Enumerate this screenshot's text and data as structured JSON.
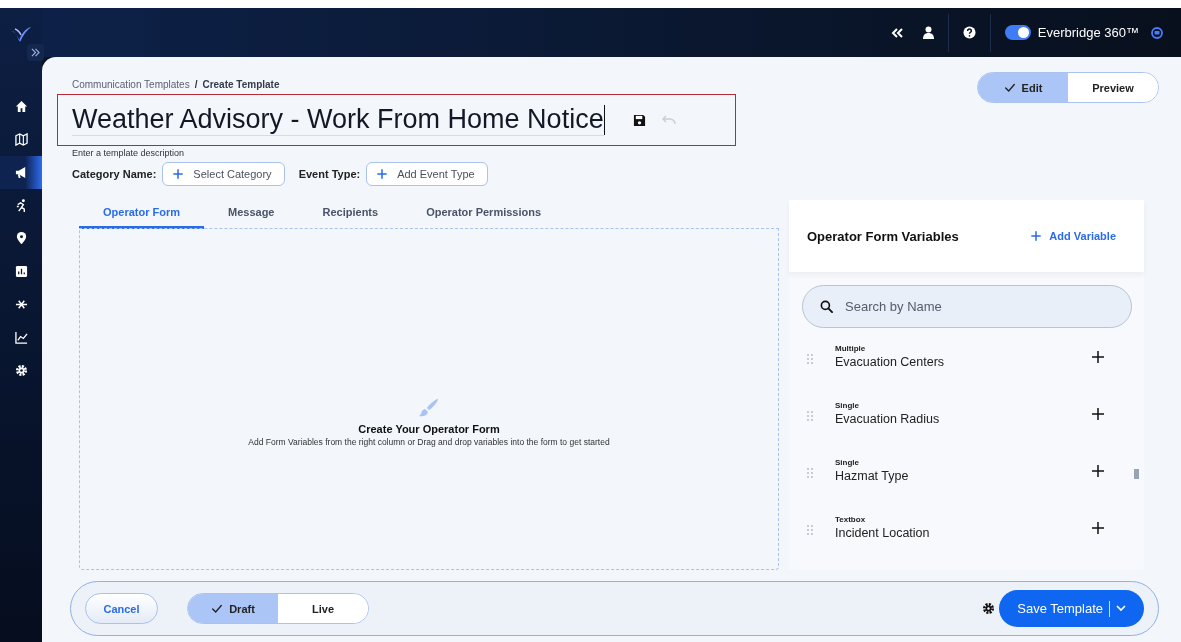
{
  "sidebar": {
    "items": [
      {
        "selected": false
      },
      {
        "selected": false
      },
      {
        "selected": true
      },
      {
        "selected": false
      },
      {
        "selected": false
      },
      {
        "selected": false
      },
      {
        "selected": false
      },
      {
        "selected": false
      },
      {
        "selected": false
      }
    ]
  },
  "top_bar": {
    "toggle": {
      "on": true,
      "label": "Everbridge 360™"
    }
  },
  "breadcrumb": {
    "items": [
      "Communication Templates",
      "Create Template"
    ],
    "separator": "/"
  },
  "mode_switch": [
    {
      "label": "Edit",
      "selected": true
    },
    {
      "label": "Preview",
      "selected": false
    }
  ],
  "title": {
    "value": "Weather Advisory - Work From Home Notice",
    "undo_disabled": true
  },
  "description": {
    "placeholder": "Enter a template description"
  },
  "fields": [
    {
      "label": "Category Name:",
      "button": "Select Category"
    },
    {
      "label": "Event Type:",
      "button": "Add Event Type"
    }
  ],
  "tabs": [
    {
      "label": "Operator Form",
      "selected": true
    },
    {
      "label": "Message",
      "selected": false
    },
    {
      "label": "Recipients",
      "selected": false
    },
    {
      "label": "Operator Permissions",
      "selected": false
    }
  ],
  "empty_state": {
    "title": "Create Your Operator Form",
    "text": "Add Form Variables from the right column or Drag and drop variables into the form to get started"
  },
  "variables_panel": {
    "title": "Operator Form Variables",
    "add_button": "Add Variable",
    "search": {
      "placeholder": "Search by Name"
    },
    "items": [
      {
        "type": "Multiple",
        "name": "Evacuation Centers"
      },
      {
        "type": "Single",
        "name": "Evacuation Radius"
      },
      {
        "type": "Single",
        "name": "Hazmat Type"
      },
      {
        "type": "Textbox",
        "name": "Incident Location"
      }
    ]
  },
  "footer": {
    "cancel": "Cancel",
    "status_switch": [
      {
        "label": "Draft",
        "selected": true
      },
      {
        "label": "Live",
        "selected": false
      }
    ],
    "save": "Save Template"
  }
}
